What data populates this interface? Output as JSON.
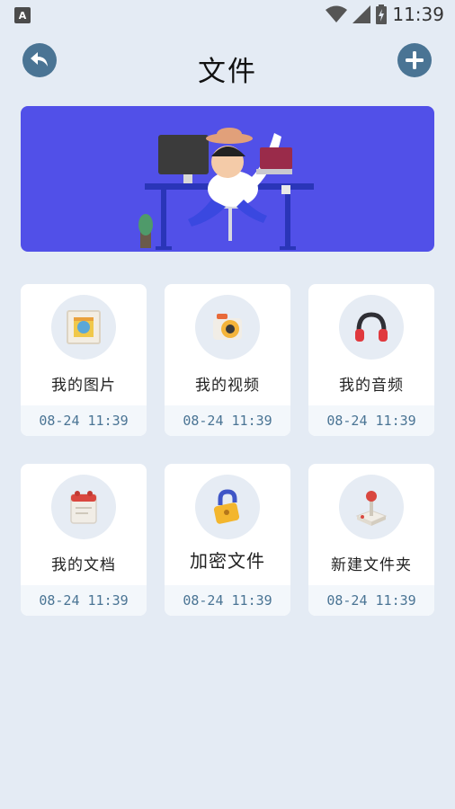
{
  "status_bar": {
    "notification_icon": "a-letter-icon",
    "notification_letter": "A",
    "time": "11:39"
  },
  "header": {
    "title": "文件"
  },
  "banner": {
    "background_color": "#5150e8"
  },
  "cards": [
    {
      "label": "我的图片",
      "timestamp": "08-24 11:39",
      "icon": "picture-frame-icon"
    },
    {
      "label": "我的视频",
      "timestamp": "08-24 11:39",
      "icon": "camera-icon"
    },
    {
      "label": "我的音频",
      "timestamp": "08-24 11:39",
      "icon": "headphones-icon"
    },
    {
      "label": "我的文档",
      "timestamp": "08-24 11:39",
      "icon": "calendar-doc-icon"
    },
    {
      "label": "加密文件",
      "timestamp": "08-24 11:39",
      "icon": "padlock-icon"
    },
    {
      "label": "新建文件夹",
      "timestamp": "08-24 11:39",
      "icon": "joystick-icon"
    }
  ],
  "colors": {
    "background": "#e4ebf4",
    "accent": "#4a7494",
    "card": "#ffffff"
  }
}
